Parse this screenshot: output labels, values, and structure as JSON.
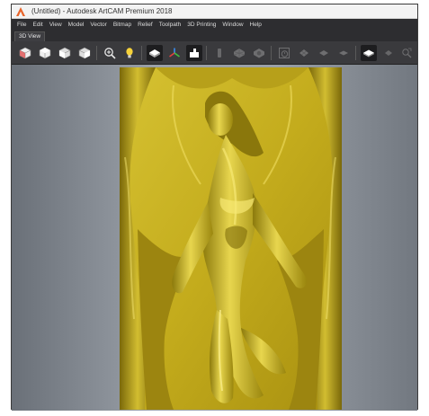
{
  "window": {
    "title": "(Untitled) - Autodesk ArtCAM Premium 2018",
    "app_icon": "artcam-logo-icon"
  },
  "menu": {
    "items": [
      "File",
      "Edit",
      "View",
      "Model",
      "Vector",
      "Bitmap",
      "Relief",
      "Toolpath",
      "3D Printing",
      "Window",
      "Help"
    ]
  },
  "tabs": {
    "active": "3D View"
  },
  "toolbar": {
    "buttons": [
      "iso-view-icon",
      "top-view-icon",
      "front-view-icon",
      "side-view-icon",
      "zoom-icon",
      "light-icon",
      "shaded-relief-icon",
      "axes-icon",
      "model-component-icon",
      "relief-layer-icon",
      "mesh-icon",
      "mesh-alt-icon",
      "timer-icon",
      "grid-toggle-icon",
      "plane-icon",
      "plane-alt-icon",
      "render-icon",
      "settings-icon",
      "zoom-extents-icon"
    ]
  },
  "colors": {
    "relief_gold": "#c8b020",
    "relief_highlight": "#f2e26a",
    "relief_shadow": "#6d5d08",
    "viewport_bg": "#9aa0a8",
    "menubar_bg": "#2d2d30"
  }
}
